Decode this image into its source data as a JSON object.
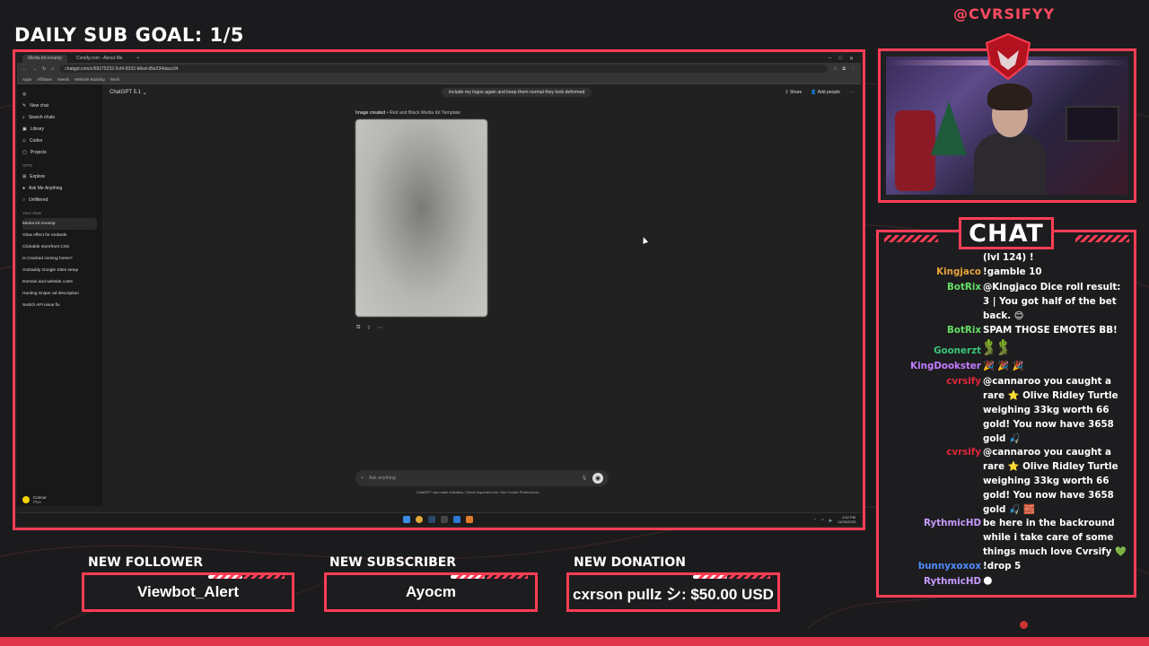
{
  "overlay": {
    "goal": "DAILY SUB GOAL: 1/5",
    "handle": "@CVRSIFYY",
    "chat_title": "CHAT",
    "accent": "#ff3d55"
  },
  "browser": {
    "tabs": [
      "Media kit revamp",
      "Cvrsify.com - About Me"
    ],
    "url": "chatgpt.com/c/69275232-5cf4-8332-b6ed-d5e234dace34",
    "bookmarks": [
      "Apps",
      "Affiliates",
      "Needs",
      "Website Building",
      "Work"
    ]
  },
  "chatgpt": {
    "model": "ChatGPT 5.1",
    "sidebar_top": [
      "New chat",
      "Search chats",
      "Library",
      "Codex",
      "Projects"
    ],
    "gpts_label": "GPTs",
    "gpts": [
      "Explore",
      "Ask Me Anything",
      "Unfiltered"
    ],
    "chats_label": "Your chats",
    "chats": [
      "Media kit revamp",
      "Glow effect for embeds",
      "Clickable storefront CSS",
      "Is Cracked coming home?",
      "GoDaddy Google Sites setup",
      "Domain and website costs",
      "Hunting Sniper ad description",
      "Switch API issue fix"
    ],
    "user_name": "Connor",
    "user_plan": "Plus",
    "user_message": "include my logos again and keep them normal they look deformed",
    "share": "Share",
    "add_people": "Add people",
    "image_caption_prefix": "Image created",
    "image_caption_title": "Red and Black Media Kit Template",
    "composer_placeholder": "Ask anything",
    "disclaimer": "ChatGPT can make mistakes. Check important info. See Cookie Preferences.",
    "clock_time": "2:52 PM",
    "clock_date": "11/26/2025"
  },
  "chat_messages": [
    {
      "name": "",
      "text": "(lvl 124) !",
      "color": "#ffffff"
    },
    {
      "name": "Kingjaco",
      "text": "!gamble 10",
      "color": "#e8a23a"
    },
    {
      "name": "BotRix",
      "text": "@Kingjaco Dice roll result: 3 | You got half of the bet back. 😊",
      "color": "#66e066"
    },
    {
      "name": "BotRix",
      "text": "SPAM THOSE EMOTES BB! 🌵 🌵",
      "color": "#66e066"
    },
    {
      "name": "Goonerzt",
      "text": "🐊 🐊",
      "color": "#3cc47a"
    },
    {
      "name": "KingDookster",
      "text": "🎉 🎉 🎉",
      "color": "#c07cff"
    },
    {
      "name": "cvrsify",
      "text": "@cannaroo you caught a rare ⭐ Olive Ridley Turtle weighing 33kg worth 66 gold! You now have 3658 gold 🎣",
      "color": "#e0273a"
    },
    {
      "name": "cvrsify",
      "text": "@cannaroo you caught a rare ⭐ Olive Ridley Turtle weighing 33kg worth 66 gold! You now have 3658 gold 🎣 🧱",
      "color": "#e0273a"
    },
    {
      "name": "RythmicHD",
      "text": "be here in the backround while i take care of some things much love Cvrsify 💚",
      "color": "#c79bff"
    },
    {
      "name": "bunnyxoxox",
      "text": "!drop 5",
      "color": "#4f8bff"
    },
    {
      "name": "RythmicHD",
      "text": "🌑",
      "color": "#c79bff"
    }
  ],
  "alerts": {
    "follower_label": "NEW FOLLOWER",
    "follower_value": "Viewbot_Alert",
    "subscriber_label": "NEW SUBSCRIBER",
    "subscriber_value": "Ayocm",
    "donation_label": "NEW DONATION",
    "donation_value": "cxrson pullz シ: $50.00 USD"
  }
}
